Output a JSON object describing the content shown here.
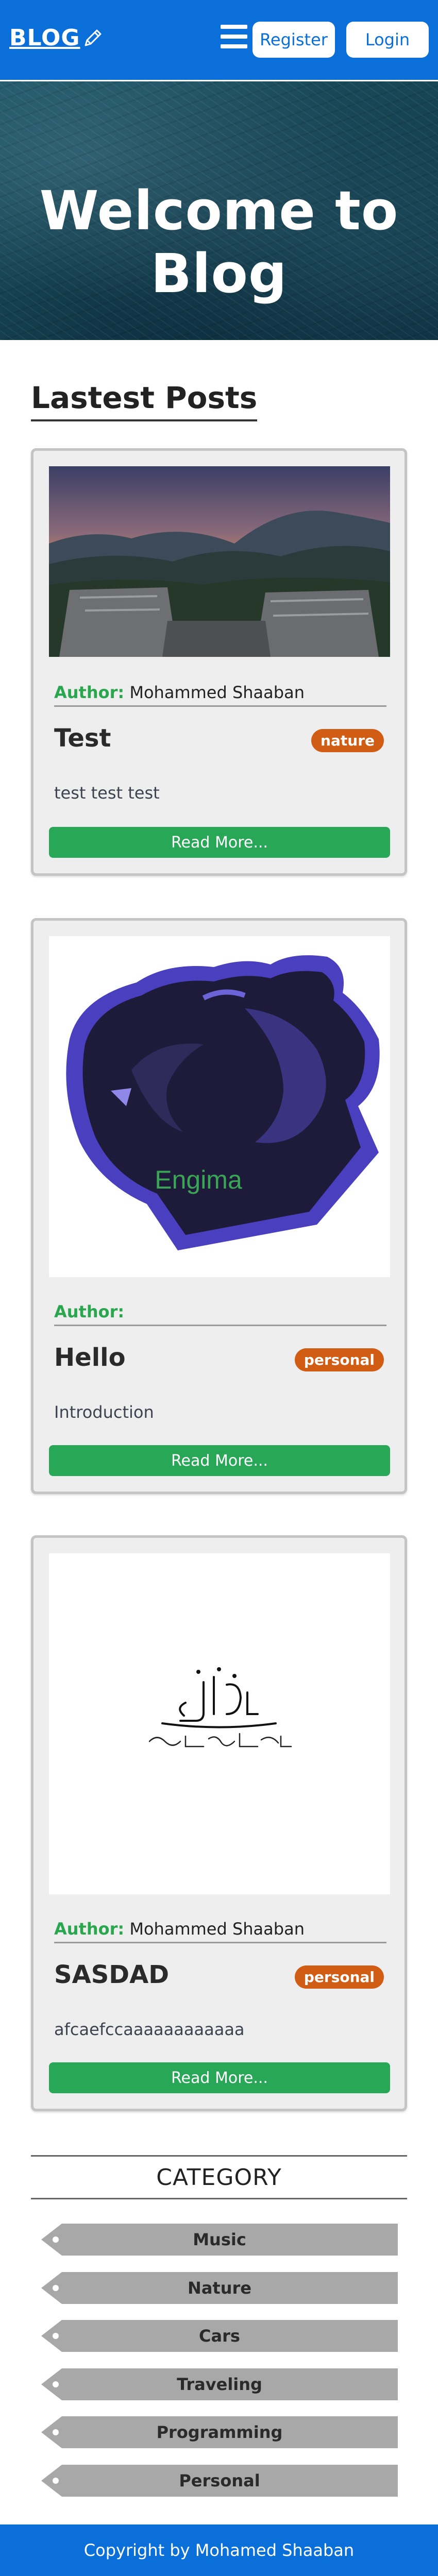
{
  "header": {
    "logo_text": "BLOG",
    "logo_icon": "pencil-icon",
    "menu_icon": "hamburger-icon",
    "register_label": "Register",
    "login_label": "Login",
    "brand_color": "#0a6fd8"
  },
  "hero": {
    "title": "Welcome to Blog"
  },
  "posts_section": {
    "title": "Lastest Posts"
  },
  "posts": [
    {
      "image": "mountain-sunset-image",
      "author_label": "Author:",
      "author_name": "Mohammed Shaaban",
      "title": "Test",
      "category": "nature",
      "description": "test test test",
      "button_label": "Read More..."
    },
    {
      "image": "engima-panther-logo-image",
      "image_text": "Engima",
      "author_label": "Author:",
      "author_name": "",
      "title": "Hello",
      "category": "personal",
      "description": "Introduction",
      "button_label": "Read More..."
    },
    {
      "image": "arabic-calligraphy-image",
      "author_label": "Author:",
      "author_name": "Mohammed Shaaban",
      "title": "SASDAD",
      "category": "personal",
      "description": "afcaefccaaaaaaaaaaaa",
      "button_label": "Read More..."
    }
  ],
  "categories": {
    "title": "CATEGORY",
    "items": [
      "Music",
      "Nature",
      "Cars",
      "Traveling",
      "Programming",
      "Personal"
    ]
  },
  "footer": {
    "text": "Copyright by Mohamed Shaaban"
  }
}
